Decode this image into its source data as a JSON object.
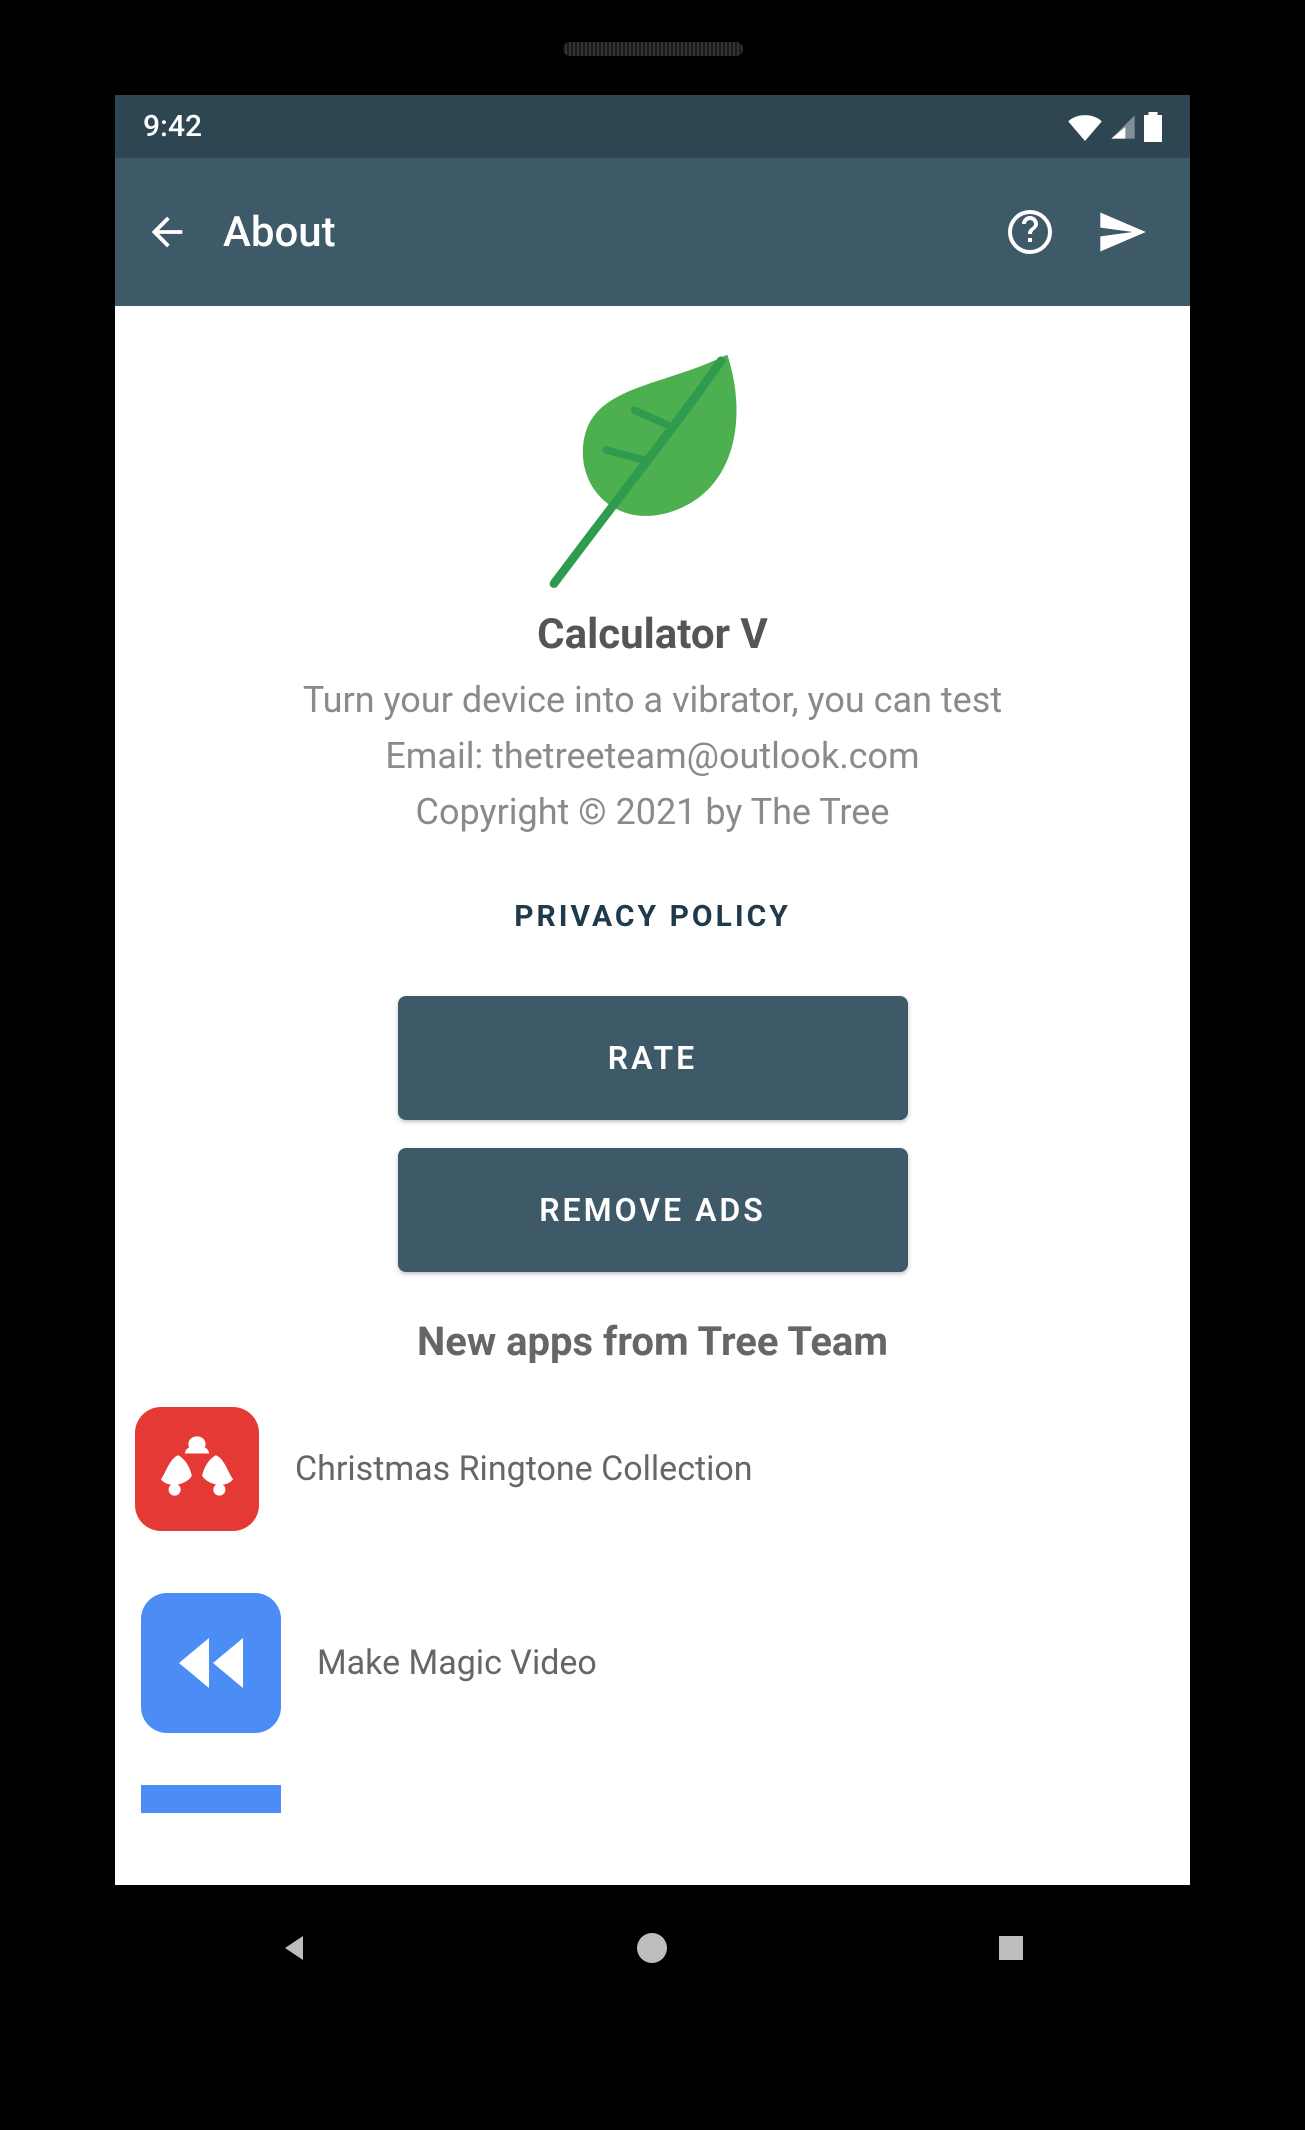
{
  "status": {
    "time": "9:42"
  },
  "appbar": {
    "title": "About"
  },
  "about": {
    "app_name": "Calculator V",
    "description": "Turn your device into a vibrator, you can test ",
    "email_line": "Email: thetreeteam@outlook.com",
    "copyright": "Copyright © 2021 by The Tree",
    "privacy_link": "PRIVACY POLICY",
    "rate_button": "RATE",
    "remove_ads_button": "REMOVE ADS",
    "new_apps_title": "New apps from Tree Team"
  },
  "apps": [
    {
      "label": "Christmas Ringtone Collection",
      "icon": "bells-icon",
      "bg": "#e53935"
    },
    {
      "label": "Make Magic Video",
      "icon": "rewind-icon",
      "bg": "#4c8df5"
    }
  ]
}
